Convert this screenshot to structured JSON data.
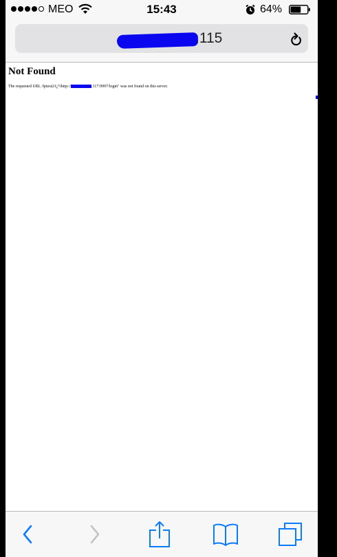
{
  "status_bar": {
    "carrier": "MEO",
    "time": "15:43",
    "battery_percent": "64%",
    "battery_level": 0.64,
    "signal_bars_filled": 4,
    "signal_bars_total": 5,
    "icons": [
      "signal-dots",
      "wifi-icon",
      "alarm-icon",
      "battery-icon"
    ]
  },
  "browser": {
    "url_visible_suffix": ".115",
    "reload_icon": "reload-icon"
  },
  "page": {
    "title": "Not Found",
    "message_prefix": "The requested URL /lptest2/ï¿½http://",
    "message_suffix": ".117:9997/login\" was not found on this server."
  },
  "toolbar": {
    "items": [
      "back-icon",
      "forward-icon",
      "share-icon",
      "bookmarks-icon",
      "tabs-icon"
    ]
  },
  "colors": {
    "redaction": "#0a06f0",
    "ios_blue": "#0a7aff",
    "disabled": "#c4c4c6",
    "chrome_bg": "#f7f7f7",
    "address_bg": "#e2e2e4"
  }
}
